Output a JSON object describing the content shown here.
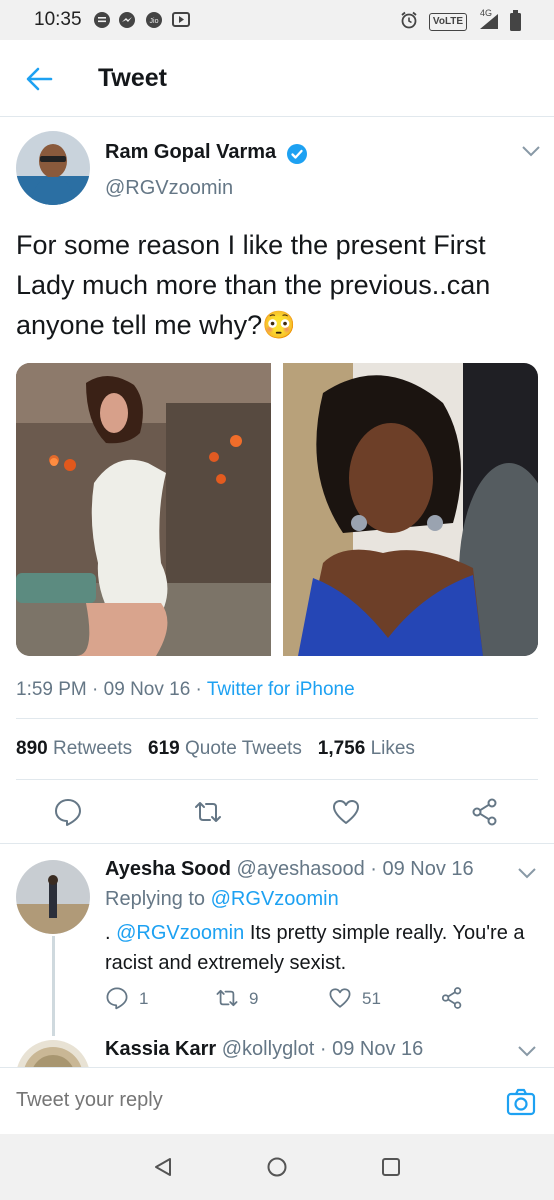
{
  "status_bar": {
    "time": "10:35",
    "volte": "VoLTE",
    "net": "4G"
  },
  "header": {
    "title": "Tweet"
  },
  "tweet": {
    "author_name": "Ram Gopal Varma",
    "author_handle": "@RGVzoomin",
    "text": "For some reason I like the present First Lady much more than the previous..can anyone tell me why?",
    "emoji": "😳",
    "time": "1:59 PM",
    "date": "09 Nov 16",
    "source": "Twitter for iPhone",
    "retweets_count": "890",
    "retweets_label": "Retweets",
    "quotes_count": "619",
    "quotes_label": "Quote Tweets",
    "likes_count": "1,756",
    "likes_label": "Likes"
  },
  "reply1": {
    "name": "Ayesha Sood",
    "handle": "@ayeshasood",
    "date": "09 Nov 16",
    "replying_label": "Replying to",
    "replying_to": "@RGVzoomin",
    "mention": "@RGVzoomin",
    "text_prefix": ".",
    "text_rest": "Its pretty simple really. You're a racist and extremely sexist.",
    "reply_count": "1",
    "retweet_count": "9",
    "like_count": "51"
  },
  "reply2": {
    "name": "Kassia Karr",
    "handle": "@kollyglot",
    "date": "09 Nov 16"
  },
  "composer": {
    "placeholder": "Tweet your reply"
  },
  "colors": {
    "accent": "#1da1f2",
    "text": "#14171a",
    "secondary": "#657786",
    "border": "#e1e8ed"
  }
}
